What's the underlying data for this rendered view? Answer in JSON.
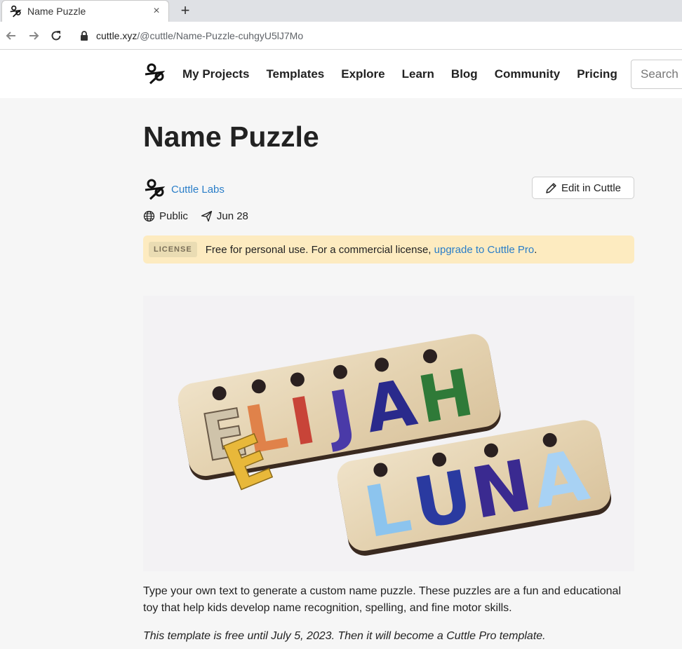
{
  "browser": {
    "tab": {
      "title": "Name Puzzle",
      "close": "×"
    },
    "new_tab": "+",
    "url_host": "cuttle.xyz",
    "url_path": "/@cuttle/Name-Puzzle-cuhgyU5lJ7Mo"
  },
  "header": {
    "nav": [
      "My Projects",
      "Templates",
      "Explore",
      "Learn",
      "Blog",
      "Community",
      "Pricing"
    ],
    "search_placeholder": "Search"
  },
  "page": {
    "title": "Name Puzzle",
    "author": "Cuttle Labs",
    "edit_label": "Edit in Cuttle",
    "visibility": "Public",
    "date": "Jun 28",
    "license": {
      "badge": "LICENSE",
      "text": "Free for personal use. For a commercial license, ",
      "link": "upgrade to Cuttle Pro",
      "end": "."
    },
    "image_words": [
      "ELIJAH",
      "LUNA",
      "E"
    ],
    "description": "Type your own text to generate a custom name puzzle. These puzzles are a fun and educational toy that help kids develop name recognition, spelling, and fine motor skills.",
    "note": "This template is free until July 5, 2023. Then it will become a Cuttle Pro template."
  }
}
